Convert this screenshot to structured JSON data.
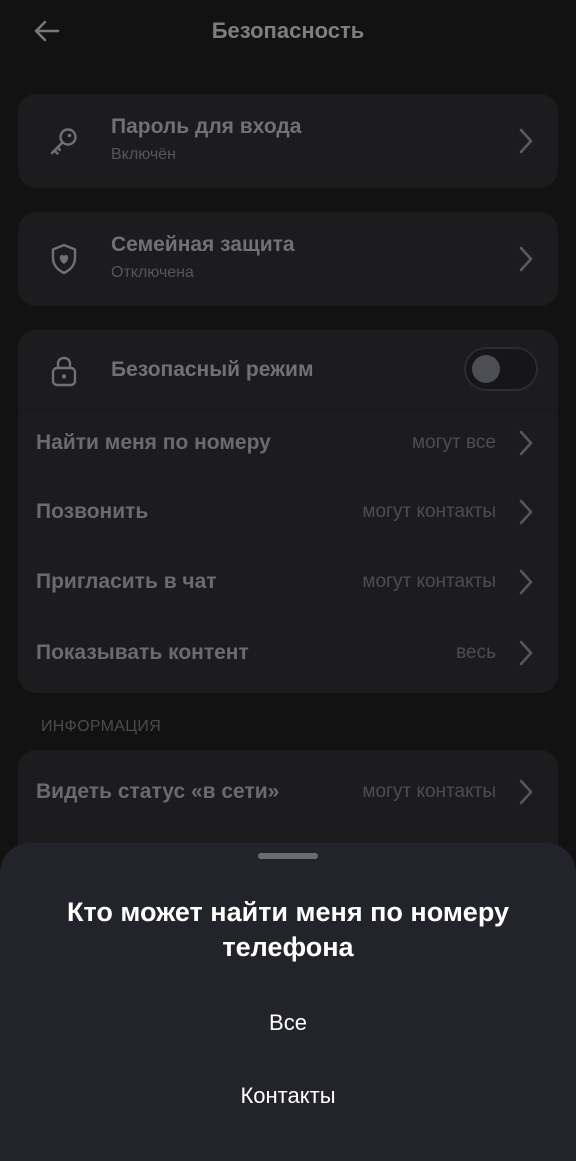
{
  "header": {
    "title": "Безопасность",
    "back_icon": "arrow-left-icon"
  },
  "password_card": {
    "title": "Пароль для входа",
    "subtitle": "Включён",
    "icon": "key-icon"
  },
  "family_card": {
    "title": "Семейная защита",
    "subtitle": "Отключена",
    "icon": "shield-heart-icon"
  },
  "privacy_card": {
    "safe_mode": {
      "title": "Безопасный режим",
      "icon": "lock-icon",
      "enabled": false
    },
    "rows": [
      {
        "label": "Найти меня по номеру",
        "value": "могут все"
      },
      {
        "label": "Позвонить",
        "value": "могут контакты"
      },
      {
        "label": "Пригласить в чат",
        "value": "могут контакты"
      },
      {
        "label": "Показывать контент",
        "value": "весь"
      }
    ]
  },
  "info_section": {
    "header": "ИНФОРМАЦИЯ",
    "rows": [
      {
        "label": "Видеть статус «в сети»",
        "value": "могут контакты"
      }
    ]
  },
  "bottom_sheet": {
    "title": "Кто может найти меня по номеру телефона",
    "options": [
      "Все",
      "Контакты"
    ]
  },
  "colors": {
    "background": "#121213",
    "card": "#1c1c1f",
    "sheet": "#23242b",
    "text_primary": "#ffffff",
    "text_dim": "#707176"
  }
}
